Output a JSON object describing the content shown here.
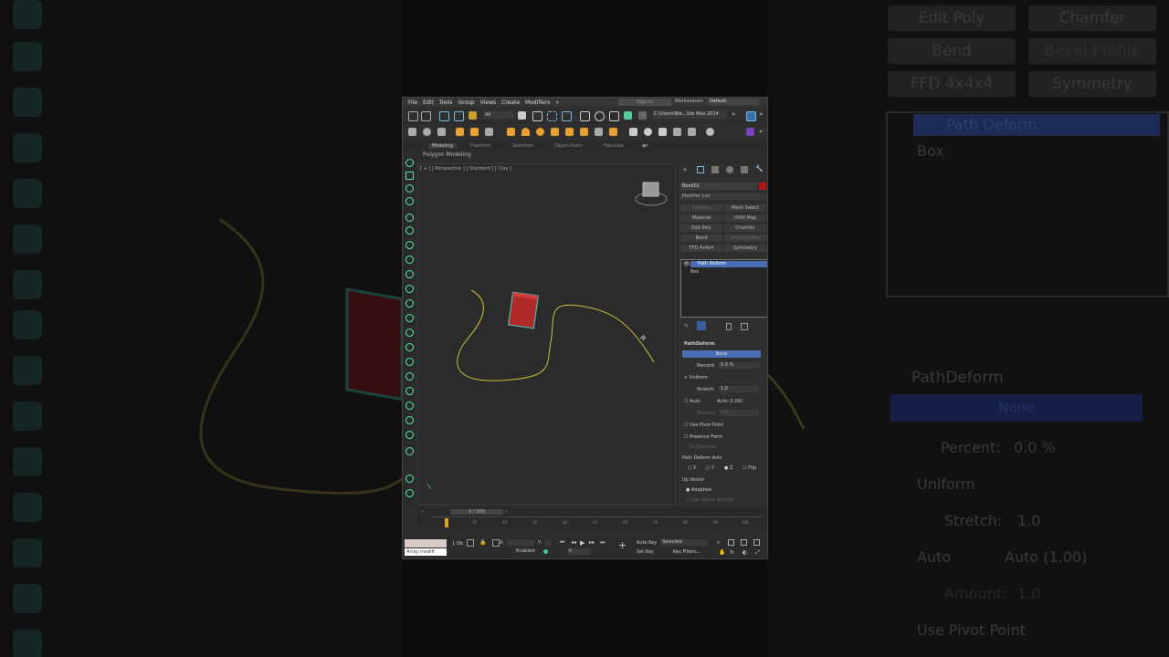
{
  "menu": [
    "File",
    "Edit",
    "Tools",
    "Group",
    "Views",
    "Create",
    "Modifiers"
  ],
  "sign_in": "Sign In",
  "workspaces_label": "Workspaces:",
  "workspace_value": "Default",
  "toolbar": {
    "selection_filter": "All",
    "project_path": "C:\\Users\\Nie...3ds Max 2024"
  },
  "ribbon_tabs": [
    "Modeling",
    "Freeform",
    "Selection",
    "Object Paint",
    "Populate"
  ],
  "ribbon_label": "Polygon Modeling",
  "viewport_label": "[ + ] [ Perspective ] [ Standard ] [ Clay ]",
  "object_name": "Box001",
  "modifier_list_label": "Modifier List",
  "modifier_buttons": [
    "Extrude",
    "Mesh Select",
    "Material",
    "UVW Map",
    "Edit Poly",
    "Chamfer",
    "Bend",
    "Bevel Profile",
    "FFD 4x4x4",
    "Symmetry"
  ],
  "stack": {
    "selected": "Path Deform",
    "base": "Box"
  },
  "rollout_title": "PathDeform",
  "path_none": "None",
  "percent_label": "Percent:",
  "percent_value": "0.0 %",
  "uniform_label": "Uniform",
  "stretch_label": "Stretch:",
  "stretch_value": "1.0",
  "auto_label": "Auto",
  "auto_value": "Auto (1.00)",
  "amount_label": "Amount:",
  "amount_value": "1.0",
  "use_pivot": "Use Pivot Point",
  "preserve_form": "Preserve Form",
  "xs_sections": "Xs Sections",
  "axis_label": "Path Deform Axis",
  "axes": [
    "X",
    "Y",
    "Z",
    "Flip"
  ],
  "up_vector": "Up Vector",
  "adaptive": "Adaptive",
  "use_spline_normal": "Use Spline Normal",
  "timeline_frame": "0 / 100",
  "ticks": [
    "10",
    "20",
    "30",
    "40",
    "50",
    "60",
    "70",
    "80",
    "90",
    "100"
  ],
  "status": {
    "script": "Array modifi",
    "selected": "1 Ob",
    "auto_key": "Auto Key",
    "selected_dd": "Selected",
    "set_key": "Set Key",
    "key_filters": "Key Filters...",
    "enabled": "Enabled:"
  },
  "backdrop": {
    "buttons": [
      "Edit Poly",
      "Chamfer",
      "Bend",
      "Bevel Profile",
      "FFD 4x4x4",
      "Symmetry"
    ],
    "stack_selected": "Path Deform",
    "stack_base": "Box",
    "rollout": "PathDeform",
    "none": "None",
    "percent": "Percent:",
    "percent_val": "0.0 %",
    "uniform": "Uniform",
    "stretch": "Stretch:",
    "stretch_val": "1.0",
    "auto": "Auto",
    "auto_val": "Auto (1.00)",
    "amount": "Amount:",
    "amount_val": "1.0",
    "pivot": "Use Pivot Point"
  },
  "colors": {
    "accent": "#4a6fb4",
    "spline": "#c8c040",
    "box": "#b02a2a"
  }
}
